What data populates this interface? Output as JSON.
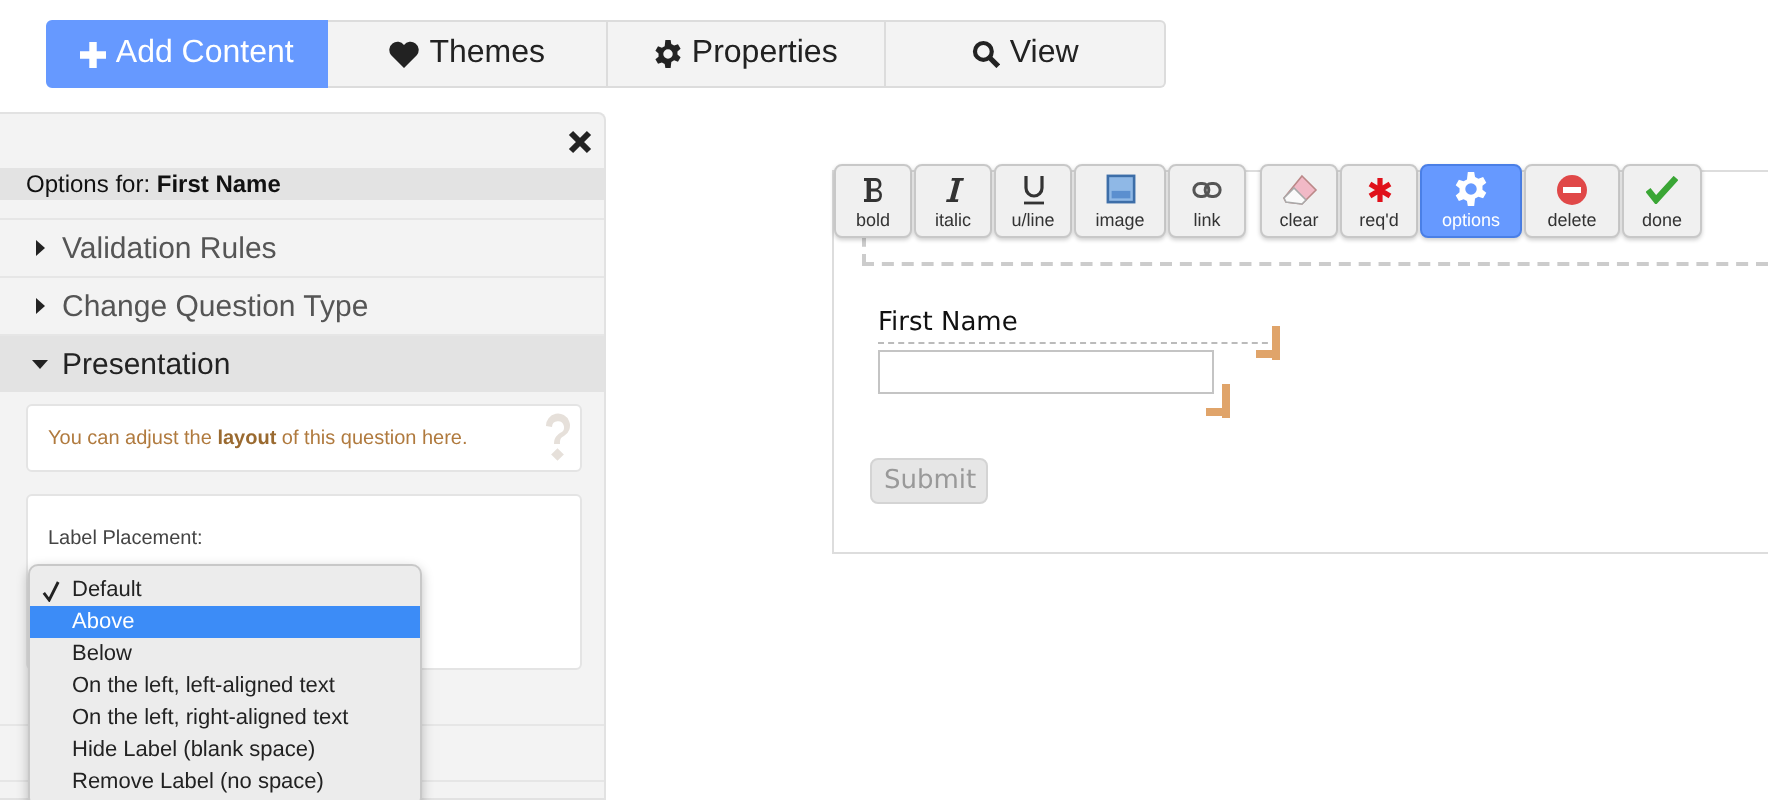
{
  "tabs": [
    {
      "label": "Add Content",
      "kind": "plus",
      "selected": true
    },
    {
      "label": "Themes",
      "kind": "heart",
      "selected": false
    },
    {
      "label": "Properties",
      "kind": "gear",
      "selected": false
    },
    {
      "label": "View",
      "kind": "search",
      "selected": false
    }
  ],
  "panel": {
    "title": "Options for: **First Name**",
    "sections": [
      {
        "label": "Validation Rules",
        "expanded": false
      },
      {
        "label": "Change Question Type",
        "expanded": false
      },
      {
        "label": "Presentation",
        "expanded": true
      }
    ],
    "hint": "You can adjust the **layout** of this question here.",
    "setting_label": "Label Placement:",
    "menu": [
      {
        "label": "Default",
        "checked": true,
        "selected": false
      },
      {
        "label": "Above",
        "checked": false,
        "selected": true
      },
      {
        "label": "Below",
        "checked": false,
        "selected": false
      },
      {
        "label": "On the left, left-aligned text",
        "checked": false,
        "selected": false
      },
      {
        "label": "On the left, right-aligned text",
        "checked": false,
        "selected": false
      },
      {
        "label": "Hide Label (blank space)",
        "checked": false,
        "selected": false
      },
      {
        "label": "Remove Label (no space)",
        "checked": false,
        "selected": false
      }
    ]
  },
  "toolbar": [
    {
      "label": "bold",
      "kind": "bold",
      "selected": false
    },
    {
      "label": "italic",
      "kind": "italic",
      "selected": false
    },
    {
      "label": "u/line",
      "kind": "underline",
      "selected": false
    },
    {
      "label": "image",
      "kind": "image",
      "selected": false
    },
    {
      "label": "link",
      "kind": "link",
      "selected": false
    },
    {
      "label": "clear",
      "kind": "eraser",
      "selected": false
    },
    {
      "label": "req'd",
      "kind": "asterisk",
      "selected": false
    },
    {
      "label": "options",
      "kind": "gear",
      "selected": true
    },
    {
      "label": "delete",
      "kind": "delete",
      "selected": false
    },
    {
      "label": "done",
      "kind": "check",
      "selected": false
    }
  ],
  "form": {
    "field_label": "First Name",
    "submit": "Submit"
  }
}
